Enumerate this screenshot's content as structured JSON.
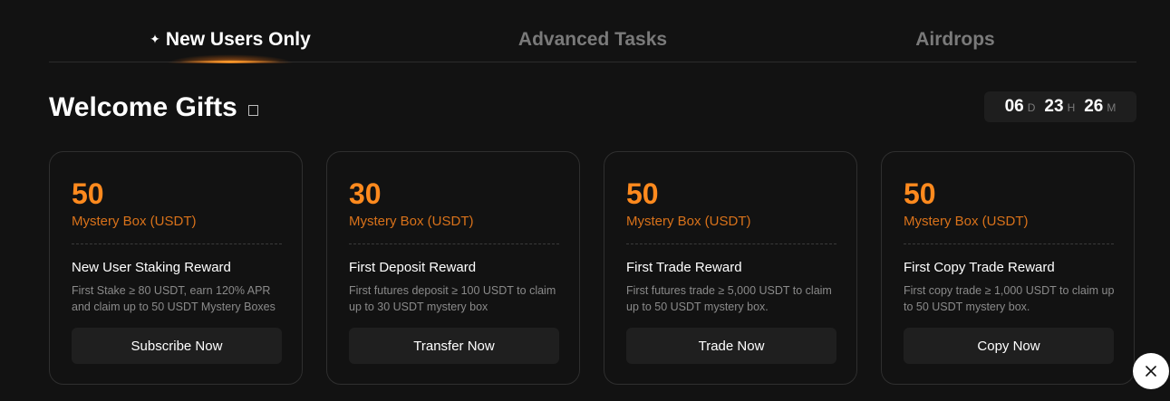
{
  "tabs": [
    {
      "label": "New Users Only",
      "active": true,
      "icon": "sparkle-icon"
    },
    {
      "label": "Advanced Tasks",
      "active": false
    },
    {
      "label": "Airdrops",
      "active": false
    }
  ],
  "section": {
    "title": "Welcome Gifts",
    "info_icon": "info-icon"
  },
  "countdown": {
    "days": "06",
    "days_label": "D",
    "hours": "23",
    "hours_label": "H",
    "minutes": "26",
    "minutes_label": "M"
  },
  "cards": [
    {
      "amount": "50",
      "unit": "Mystery Box (USDT)",
      "title": "New User Staking Reward",
      "description": "First Stake ≥ 80 USDT, earn 120% APR and claim up to 50 USDT Mystery Boxes",
      "button": "Subscribe Now"
    },
    {
      "amount": "30",
      "unit": "Mystery Box (USDT)",
      "title": "First Deposit Reward",
      "description": "First futures deposit ≥ 100 USDT to claim up to 30 USDT mystery box",
      "button": "Transfer Now"
    },
    {
      "amount": "50",
      "unit": "Mystery Box (USDT)",
      "title": "First Trade Reward",
      "description": "First futures trade ≥ 5,000 USDT to claim up to 50 USDT mystery box.",
      "button": "Trade Now"
    },
    {
      "amount": "50",
      "unit": "Mystery Box (USDT)",
      "title": "First Copy Trade Reward",
      "description": "First copy trade ≥ 1,000 USDT to claim up to 50 USDT mystery box.",
      "button": "Copy Now"
    }
  ],
  "close_button": {
    "icon": "close-icon"
  },
  "colors": {
    "background": "#121212",
    "accent_orange": "#ff8a1e",
    "muted_text": "#8a8a8a",
    "inactive_tab": "#7a7a7a"
  }
}
